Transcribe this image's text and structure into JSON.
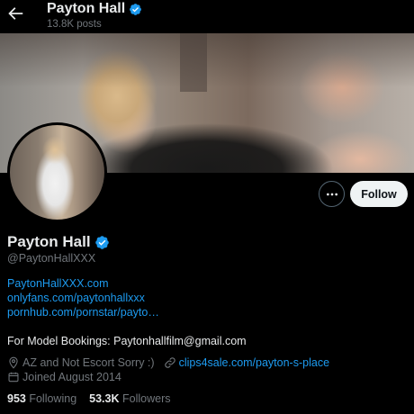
{
  "header": {
    "name": "Payton Hall",
    "posts": "13.8K posts"
  },
  "actions": {
    "follow_label": "Follow"
  },
  "profile": {
    "name": "Payton Hall",
    "handle": "@PaytonHallXXX",
    "links": [
      "PaytonHallXXX.com",
      "onlyfans.com/paytonhallxxx",
      "pornhub.com/pornstar/payto…"
    ],
    "bio_line": "For Model Bookings: Paytonhallfilm@gmail.com",
    "location": "AZ and Not Escort Sorry :)",
    "website": "clips4sale.com/payton-s-place",
    "joined": "Joined August 2014"
  },
  "stats": {
    "following_count": "953",
    "following_label": "Following",
    "followers_count": "53.3K",
    "followers_label": "Followers"
  },
  "colors": {
    "background": "#000000",
    "text": "#e7e9ea",
    "muted": "#71767b",
    "link": "#1d9bf0",
    "verified": "#1d9bf0",
    "follow_button_bg": "#eff3f4"
  },
  "icons": {
    "back": "arrow-left-icon",
    "verified": "verified-badge-icon",
    "more": "more-horizontal-icon",
    "location": "location-pin-icon",
    "website": "link-icon",
    "joined": "calendar-icon"
  }
}
